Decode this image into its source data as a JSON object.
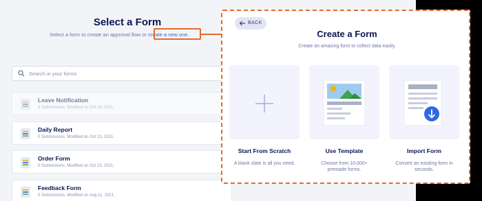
{
  "background": {
    "title": "Select a Form",
    "subtitle_text": "Select a form to create an approval flow or",
    "subtitle_link": "create a new one.",
    "search_placeholder": "Search in your forms",
    "forms": [
      {
        "name": "Leave Notification",
        "meta": "4 Submissions. Modified on Oct 14, 2021."
      },
      {
        "name": "Daily Report",
        "meta": "0 Submissions. Modified on Oct 13, 2021."
      },
      {
        "name": "Order Form",
        "meta": "0 Submissions. Modified on Oct 13, 2021."
      },
      {
        "name": "Feedback Form",
        "meta": "0 Submissions. Modified on Aug 11, 2021."
      }
    ]
  },
  "modal": {
    "back_label": "BACK",
    "title": "Create a Form",
    "subtitle": "Create an amazing form to collect data easily.",
    "options": [
      {
        "title": "Start From Scratch",
        "desc1": "A blank slate is all you need.",
        "desc2": "",
        "icon": "plus-icon"
      },
      {
        "title": "Use Template",
        "desc1": "Choose from 10,000+",
        "desc2": "premade forms.",
        "icon": "template-icon"
      },
      {
        "title": "Import Form",
        "desc1": "Convert an existing form in",
        "desc2": "seconds.",
        "icon": "import-icon"
      }
    ]
  },
  "colors": {
    "accent_orange": "#e06c2a",
    "navy": "#0a1551",
    "link_blue": "#3e62c8",
    "import_blue": "#2e69e3"
  }
}
